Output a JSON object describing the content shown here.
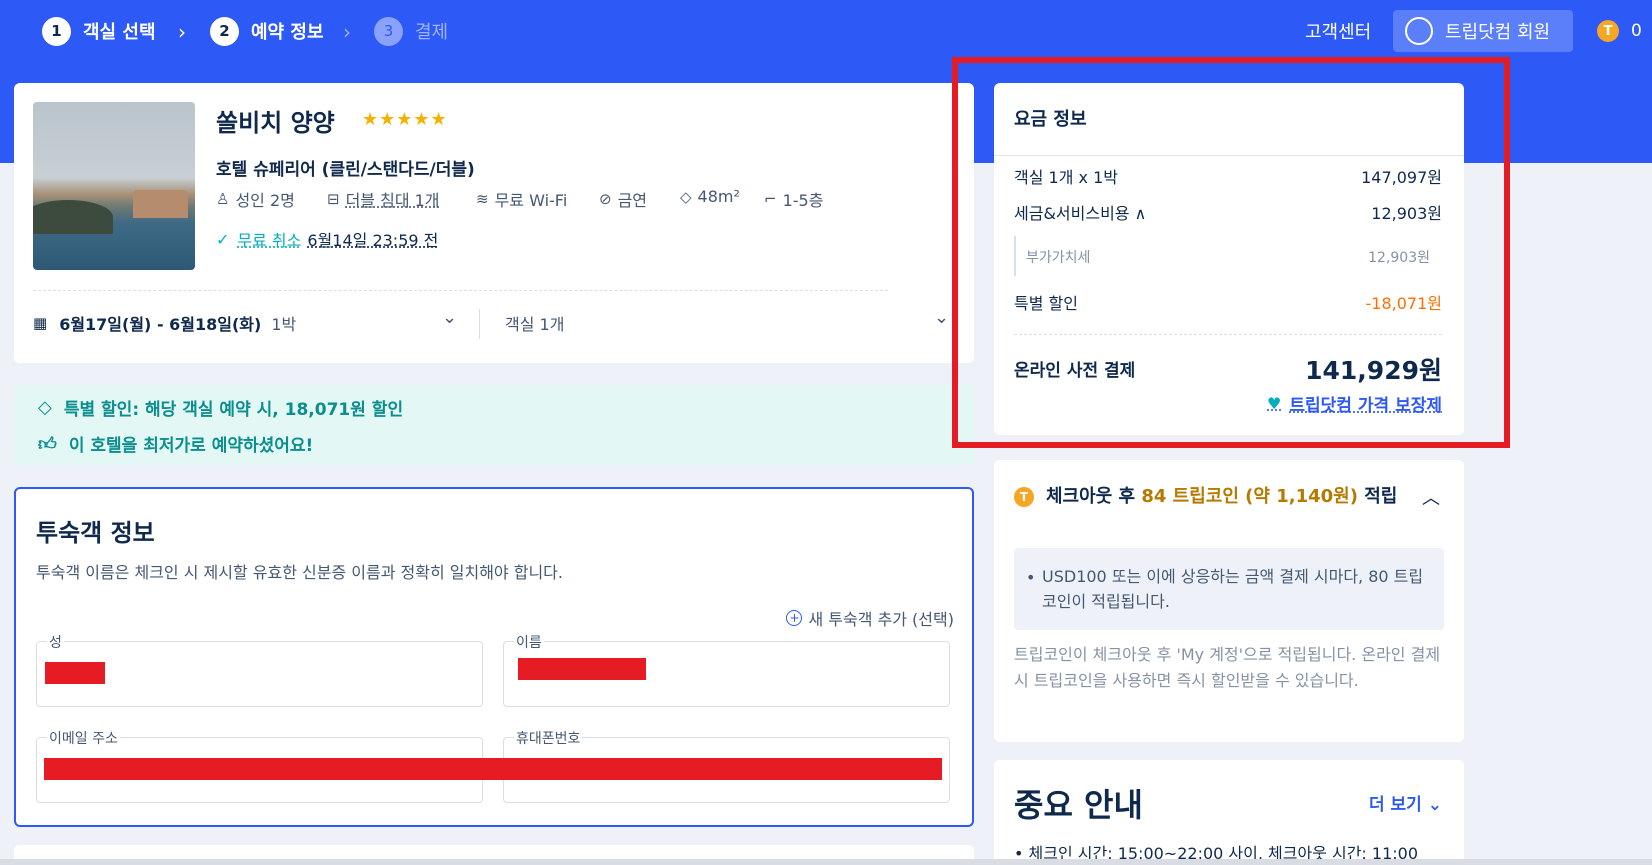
{
  "steps": [
    {
      "num": "1",
      "label": "객실 선택"
    },
    {
      "num": "2",
      "label": "예약 정보"
    },
    {
      "num": "3",
      "label": "결제"
    }
  ],
  "header": {
    "support": "고객센터",
    "member": "트립닷컴 회원",
    "coin_icon": "T",
    "coin_count": "0"
  },
  "hotel": {
    "name": "쏠비치 양양",
    "stars": "★★★★★",
    "room": "호텔 슈페리어 (클린/스탠다드/더블)",
    "amenities": [
      {
        "icon": "person-icon",
        "label": "성인 2명"
      },
      {
        "icon": "bed-icon",
        "label": "더블 침대 1개"
      },
      {
        "icon": "wifi-icon",
        "label": "무료 Wi-Fi"
      },
      {
        "icon": "no-smoking-icon",
        "label": "금연"
      },
      {
        "icon": "area-icon",
        "label": "48m²"
      },
      {
        "icon": "stairs-icon",
        "label": "1-5층"
      }
    ],
    "cancel_free": "무료 취소",
    "cancel_deadline": "6월14일 23:59 전",
    "dates": "6월17일(월) - 6월18일(화)",
    "nights": "1박",
    "rooms": "객실 1개"
  },
  "promo": {
    "discount": "특별 할인: 해당 객실 예약 시, 18,071원 할인",
    "best_price": "이 호텔을 최저가로 예약하셨어요!"
  },
  "guest": {
    "title": "투숙객 정보",
    "description": "투숙객 이름은 체크인 시 제시할 유효한 신분증 이름과 정확히 일치해야 합니다.",
    "add_guest": "새 투숙객 추가 (선택)",
    "last_name_label": "성",
    "first_name_label": "이름",
    "email_label": "이메일 주소",
    "phone_label": "휴대폰번호"
  },
  "price": {
    "title": "요금 정보",
    "rows": [
      {
        "label": "객실 1개 x 1박",
        "value": "147,097원"
      },
      {
        "label": "세금&서비스비용 ∧",
        "value": "12,903원"
      },
      {
        "label": "부가가치세",
        "value": "12,903원"
      },
      {
        "label": "특별 할인",
        "value": "-18,071원"
      }
    ],
    "total_label": "온라인 사전 결제",
    "total_value": "141,929원",
    "guarantee": "트립닷컴 가격 보장제"
  },
  "coin_reward": {
    "prefix": "체크아웃 후 ",
    "highlight": "84 트립코인 (약 1,140원)",
    "suffix": " 적립",
    "bullet": "USD100 또는 이에 상응하는 금액 결제 시마다, 80 트립코인이 적립됩니다.",
    "note": "트립코인이 체크아웃 후 'My 계정'으로 적립됩니다. 온라인 결제 시 트립코인을 사용하면 즉시 할인받을 수 있습니다."
  },
  "notice": {
    "title": "중요 안내",
    "more": "더 보기",
    "item": "체크인 시간: 15:00~22:00 사이, 체크아웃 시간: 11:00"
  },
  "colors": {
    "brand_blue": "#2d59f7",
    "teal": "#06aebd",
    "discount_orange": "#ff6f00",
    "highlight_red": "#e51c23"
  }
}
